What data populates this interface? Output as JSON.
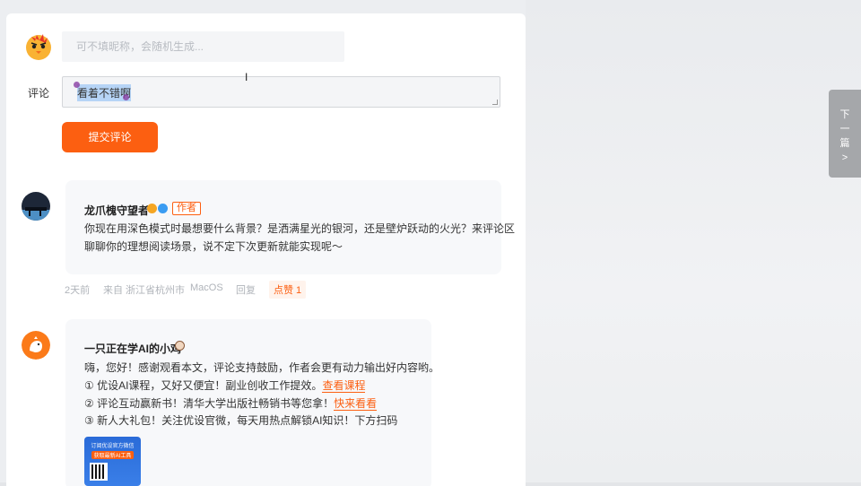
{
  "form": {
    "nickname_placeholder": "可不填昵称，会随机生成...",
    "comment_label": "评论",
    "comment_value": "看着不错啊",
    "submit_label": "提交评论"
  },
  "comments": [
    {
      "author": "龙爪槐守望者",
      "author_badge": "作者",
      "lines": [
        "你现在用深色模式时最想要什么背景？是洒满星光的银河，还是壁炉跃动的火光？来评论区",
        "聊聊你的理想阅读场景，说不定下次更新就能实现呢～"
      ],
      "time": "2天前",
      "location": "来自 浙江省杭州市",
      "os": "MacOS",
      "reply_label": "回复",
      "like_label": "点赞 1"
    },
    {
      "author": "一只正在学AI的小鸡",
      "greeting": "嗨，您好！感谢观看本文，评论支持鼓励，作者会更有动力输出好内容哟。",
      "line1_prefix": "① 优设AI课程，又好又便宜！副业创收工作提效。",
      "line1_link": "查看课程",
      "line2_prefix": "② 评论互动赢新书！清华大学出版社畅销书等您拿！",
      "line2_link": "快来看看",
      "line3": "③ 新人大礼包！关注优设官微，每天用热点解锁AI知识！下方扫码",
      "qr_title": "订阅优设官方微信",
      "qr_subtitle": "获取最新AI工具"
    }
  ],
  "next_tab": {
    "chars": [
      "下",
      "一",
      "篇",
      ">"
    ]
  },
  "colors": {
    "accent": "#fc5f11",
    "card_bg": "#f7f8fa"
  }
}
